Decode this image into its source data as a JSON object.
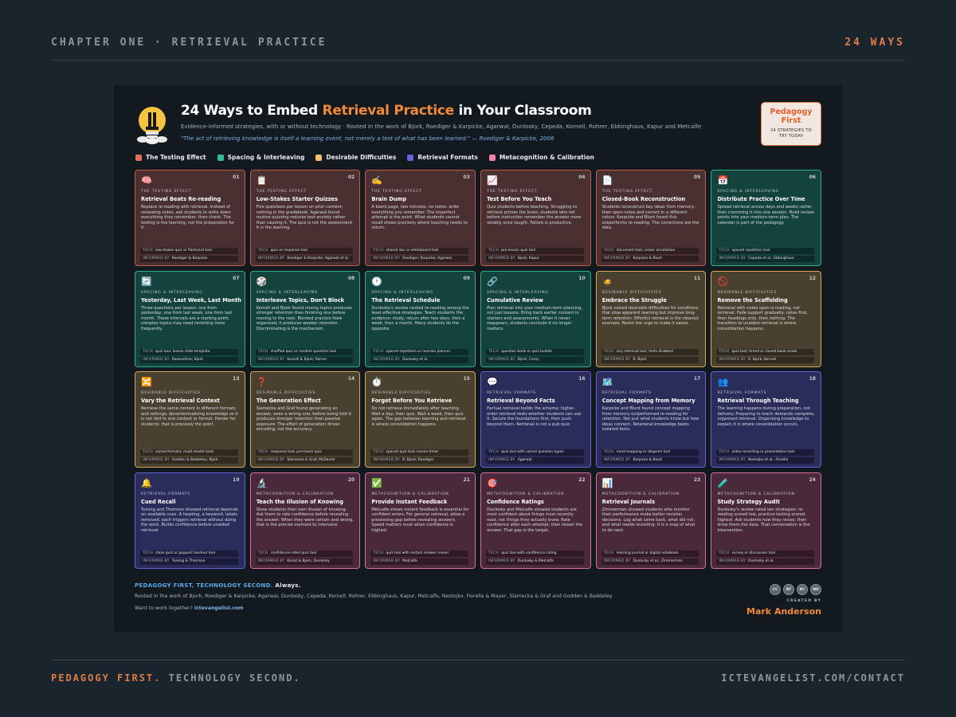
{
  "page": {
    "top_left": "CHAPTER ONE · RETRIEVAL PRACTICE",
    "top_right": "24 WAYS",
    "bottom_left_accent": "PEDAGOGY FIRST.",
    "bottom_left_rest": "TECHNOLOGY SECOND.",
    "bottom_right": "ICTEVANGELIST.COM/CONTACT"
  },
  "header": {
    "title_pre": "24 Ways to Embed ",
    "title_highlight": "Retrieval Practice",
    "title_post": " in Your Classroom",
    "subtitle": "Evidence-informed strategies, with or without technology · Rooted in the work of Bjork, Roediger & Karpicke, Agarwal, Dunlosky, Cepeda, Kornell, Rohrer, Ebbinghaus, Kapur and Metcalfe",
    "quote": "\"The act of retrieving knowledge is itself a learning event, not merely a test of what has been learned.\" — Roediger & Karpicke, 2006",
    "badge_title": "Pedagogy First",
    "badge_sub_1": "24 STRATEGIES TO",
    "badge_sub_2": "TRY TODAY"
  },
  "legend": [
    {
      "label": "The Testing Effect",
      "color": "#e0705a"
    },
    {
      "label": "Spacing & Interleaving",
      "color": "#2fbf95"
    },
    {
      "label": "Desirable Difficulties",
      "color": "#f0c070"
    },
    {
      "label": "Retrieval Formats",
      "color": "#6a60e0"
    },
    {
      "label": "Metacognition & Calibration",
      "color": "#f080a8"
    }
  ],
  "labels": {
    "tech": "TECH",
    "informed": "INFORMED BY"
  },
  "cards": [
    {
      "num": "01",
      "cls": "t",
      "icon": "🧠",
      "icon_name": "brain-icon",
      "cat": "THE TESTING EFFECT",
      "title": "Retrieval Beats Re-reading",
      "body": "Replace re-reading with retrieval. Instead of reviewing notes, ask students to write down everything they remember, then check. The testing is the learning, not the preparation for it.",
      "tech": "low-stakes quiz or flashcard tool",
      "informed": "Roediger & Karpicke"
    },
    {
      "num": "02",
      "cls": "t",
      "icon": "📋",
      "icon_name": "clipboard-icon",
      "cat": "THE TESTING EFFECT",
      "title": "Low-Stakes Starter Quizzes",
      "body": "Five questions per lesson on prior content; nothing in the gradebook. Agarwal found routine quizzing reduces test anxiety rather than causing it. The quiz is not the assessment. It is the learning.",
      "tech": "quiz or response tool",
      "informed": "Roediger & Karpicke; Agarwal et al."
    },
    {
      "num": "03",
      "cls": "t",
      "icon": "✍️",
      "icon_name": "writing-hand-icon",
      "cat": "THE TESTING EFFECT",
      "title": "Brain Dump",
      "body": "A blank page, two minutes, no notes: write everything you remember. The imperfect attempt is the point. What students cannot recall shows precisely where teaching needs to return.",
      "tech": "shared doc or whiteboard tool",
      "informed": "Roediger; Karpicke; Agarwal"
    },
    {
      "num": "04",
      "cls": "t",
      "icon": "📈",
      "icon_name": "chart-increasing-icon",
      "cat": "THE TESTING EFFECT",
      "title": "Test Before You Teach",
      "body": "Quiz students before teaching. Struggling to retrieve primes the brain; students who fail before instruction remember the answer more reliably once taught. Failure is productive.",
      "tech": "pre-lesson quiz tool",
      "informed": "Bjork; Kapur"
    },
    {
      "num": "05",
      "cls": "t",
      "icon": "📄",
      "icon_name": "document-icon",
      "cat": "THE TESTING EFFECT",
      "title": "Closed-Book Reconstruction",
      "body": "Students reconstruct key ideas from memory, then open notes and correct in a different colour. Karpicke and Blunt found this outperforms re-reading. The corrections are the data.",
      "tech": "document tool; colour annotation",
      "informed": "Karpicke & Blunt"
    },
    {
      "num": "06",
      "cls": "s",
      "icon": "📅",
      "icon_name": "calendar-icon",
      "cat": "SPACING & INTERLEAVING",
      "title": "Distribute Practice Over Time",
      "body": "Spread retrieval across days and weeks rather than cramming it into one session. Build review points into your medium-term plan. The calendar is part of the pedagogy.",
      "tech": "spaced repetition tool",
      "informed": "Cepeda et al.; Ebbinghaus"
    },
    {
      "num": "07",
      "cls": "s",
      "icon": "🔄",
      "icon_name": "cycle-arrows-icon",
      "cat": "SPACING & INTERLEAVING",
      "title": "Yesterday, Last Week, Last Month",
      "body": "Three questions per lesson: one from yesterday, one from last week, one from last month. These intervals are a starting point; complex topics may need revisiting more frequently.",
      "tech": "quiz tool; lesson slide template",
      "informed": "Rosenshine; Bjork"
    },
    {
      "num": "08",
      "cls": "s",
      "icon": "🎲",
      "icon_name": "dice-icon",
      "cat": "SPACING & INTERLEAVING",
      "title": "Interleave Topics, Don't Block",
      "body": "Kornell and Bjork found mixing topics produces stronger retention than finishing one before moving to the next. Blocked practice feels organised; it produces weaker retention. Discriminating is the mechanism.",
      "tech": "shuffled quiz or random question tool",
      "informed": "Kornell & Bjork; Rohrer"
    },
    {
      "num": "09",
      "cls": "s",
      "icon": "🕐",
      "icon_name": "clock-icon",
      "cat": "SPACING & INTERLEAVING",
      "title": "The Retrieval Schedule",
      "body": "Dunlosky's review ranked re-reading among the least effective strategies. Teach students the evidence: study, return after two days, then a week, then a month. Many students do the opposite.",
      "tech": "spaced repetition or revision planner",
      "informed": "Dunlosky et al."
    },
    {
      "num": "10",
      "cls": "s",
      "icon": "🔗",
      "icon_name": "link-icon",
      "cat": "SPACING & INTERLEAVING",
      "title": "Cumulative Review",
      "body": "Plan retrieval into your medium-term planning, not just lessons. Bring back earlier content in starters and assessments. When it never reappears, students conclude it no longer matters.",
      "tech": "question bank or quiz builder",
      "informed": "Bjork; Carey"
    },
    {
      "num": "11",
      "cls": "d",
      "icon": "🧔",
      "icon_name": "person-icon",
      "cat": "DESIRABLE DIFFICULTIES",
      "title": "Embrace the Struggle",
      "body": "Bjork coined desirable difficulties for conditions that slow apparent learning but improve long-term retention. Effortful retrieval is the clearest example. Resist the urge to make it easier.",
      "tech": "any retrieval tool; hints disabled",
      "informed": "R. Bjork"
    },
    {
      "num": "12",
      "cls": "d",
      "icon": "🚫",
      "icon_name": "no-entry-icon",
      "cat": "DESIRABLE DIFFICULTIES",
      "title": "Remove the Scaffolding",
      "body": "Retrieval with notes open is reading, not retrieval. Fade support gradually: notes first, then headings only, then nothing. The transition to unaided retrieval is where consolidation happens.",
      "tech": "quiz tool; timed or closed-book mode",
      "informed": "R. Bjork; Kornell"
    },
    {
      "num": "13",
      "cls": "d",
      "icon": "🔀",
      "icon_name": "shuffle-icon",
      "cat": "DESIRABLE DIFFICULTIES",
      "title": "Vary the Retrieval Context",
      "body": "Retrieve the same content in different formats and settings; decontextualising knowledge so it is not tied to one context or format. Harder for students; that is precisely the point.",
      "tech": "varied formats; multi-modal tools",
      "informed": "Godden & Baddeley; Bjork"
    },
    {
      "num": "14",
      "cls": "d",
      "icon": "❓",
      "icon_name": "question-mark-icon",
      "cat": "DESIRABLE DIFFICULTIES",
      "title": "The Generation Effect",
      "body": "Slamecka and Graf found generating an answer, even a wrong one, before being told it produces stronger retention than passive exposure. The effort of generation drives encoding, not the accuracy.",
      "tech": "response tool; pre-teach quiz",
      "informed": "Slamecka & Graf; McDaniel"
    },
    {
      "num": "15",
      "cls": "d",
      "icon": "⏱️",
      "icon_name": "stopwatch-icon",
      "cat": "DESIRABLE DIFFICULTIES",
      "title": "Forget Before You Retrieve",
      "body": "Do not retrieve immediately after teaching. Wait a day, then quiz. Wait a week, then quiz again. The gap between learning and retrieval is where consolidation happens.",
      "tech": "spaced quiz tool; lesson timer",
      "informed": "R. Bjork; Roediger"
    },
    {
      "num": "16",
      "cls": "r",
      "icon": "💬",
      "icon_name": "speech-bubble-icon",
      "cat": "RETRIEVAL FORMATS",
      "title": "Retrieval Beyond Facts",
      "body": "Factual retrieval builds the schema; higher-order retrieval tests whether students can use it. Secure the foundations first, then push beyond them. Retrieval is not a pub quiz.",
      "tech": "quiz tool with varied question types",
      "informed": "Agarwal"
    },
    {
      "num": "17",
      "cls": "r",
      "icon": "🗺️",
      "icon_name": "map-icon",
      "cat": "RETRIEVAL FORMATS",
      "title": "Concept Mapping from Memory",
      "body": "Karpicke and Blunt found concept mapping from memory outperformed re-reading for retention. Not just what students know but how ideas connect. Relational knowledge beats isolated facts.",
      "tech": "mind-mapping or diagram tool",
      "informed": "Karpicke & Blunt"
    },
    {
      "num": "18",
      "cls": "r",
      "icon": "👥",
      "icon_name": "people-icon",
      "cat": "RETRIEVAL FORMATS",
      "title": "Retrieval Through Teaching",
      "body": "The learning happens during preparation, not delivery. Preparing to teach demands complete, organised retrieval. Organising knowledge to explain it is where consolidation occurs.",
      "tech": "video recording or presentation tool",
      "informed": "Nestojko et al.; Fiorella"
    },
    {
      "num": "19",
      "cls": "r",
      "icon": "🔔",
      "icon_name": "bell-icon",
      "cat": "RETRIEVAL FORMATS",
      "title": "Cued Recall",
      "body": "Tulving and Thomson showed retrieval depends on available cues. A heading, a keyword, labels removed: each triggers retrieval without doing the work. Builds confidence before unaided retrieval.",
      "tech": "cloze quiz or gapped handout tool",
      "informed": "Tulving & Thomson"
    },
    {
      "num": "20",
      "cls": "m",
      "icon": "🔬",
      "icon_name": "microscope-icon",
      "cat": "METACOGNITION & CALIBRATION",
      "title": "Teach the Illusion of Knowing",
      "body": "Show students their own illusion of knowing. Ask them to rate confidence before revealing the answer. When they were certain and wrong, that is the precise moment to intervene.",
      "tech": "confidence-rated quiz tool",
      "informed": "Koriat & Bjork; Dunlosky"
    },
    {
      "num": "21",
      "cls": "m",
      "icon": "✅",
      "icon_name": "check-mark-icon",
      "cat": "METACOGNITION & CALIBRATION",
      "title": "Provide Instant Feedback",
      "body": "Metcalfe shows instant feedback is essential for confident errors. For general retrieval, allow a processing gap before revealing answers. Speed matters most when confidence is highest.",
      "tech": "quiz tool with instant answer reveal",
      "informed": "Metcalfe"
    },
    {
      "num": "22",
      "cls": "m",
      "icon": "🎯",
      "icon_name": "target-icon",
      "cat": "METACOGNITION & CALIBRATION",
      "title": "Confidence Ratings",
      "body": "Dunlosky and Metcalfe showed students are most confident about things most recently read, not things they actually know. Rate confidence after each attempt, then reveal the answer. That gap is the target.",
      "tech": "quiz tool with confidence rating",
      "informed": "Dunlosky & Metcalfe"
    },
    {
      "num": "23",
      "cls": "m",
      "icon": "📊",
      "icon_name": "bar-chart-icon",
      "cat": "METACOGNITION & CALIBRATION",
      "title": "Retrieval Journals",
      "body": "Zimmerman showed students who monitor their performance make better revision decisions. Log what came back, what did not, and what needs revisiting. It is a map of what to do next.",
      "tech": "learning journal or digital notebook",
      "informed": "Dunlosky et al.; Zimmerman"
    },
    {
      "num": "24",
      "cls": "m",
      "icon": "🧪",
      "icon_name": "test-tube-icon",
      "cat": "METACOGNITION & CALIBRATION",
      "title": "Study Strategy Audit",
      "body": "Dunlosky's review rated ten strategies: re-reading scored low, practice testing scored highest. Ask students how they revise, then show them the data. That conversation is the intervention.",
      "tech": "survey or discussion tool",
      "informed": "Dunlosky et al."
    }
  ],
  "footer": {
    "head_accent": "PEDAGOGY FIRST, TECHNOLOGY SECOND.",
    "head_rest": " Always.",
    "roots": "Rooted in the work of Bjork, Roediger & Karpicke, Agarwal, Dunlosky, Cepeda, Kornell, Rohrer, Ebbinghaus, Kapur, Metcalfe, Nestojko, Fiorella & Mayer, Slamecka & Graf and Godden & Baddeley",
    "work_pre": "Want to work together? ",
    "work_link": "ictevangelist.com",
    "cc": [
      "CC",
      "BY",
      "NC",
      "ND"
    ],
    "created_by": "CREATED BY",
    "author": "Mark Anderson"
  }
}
